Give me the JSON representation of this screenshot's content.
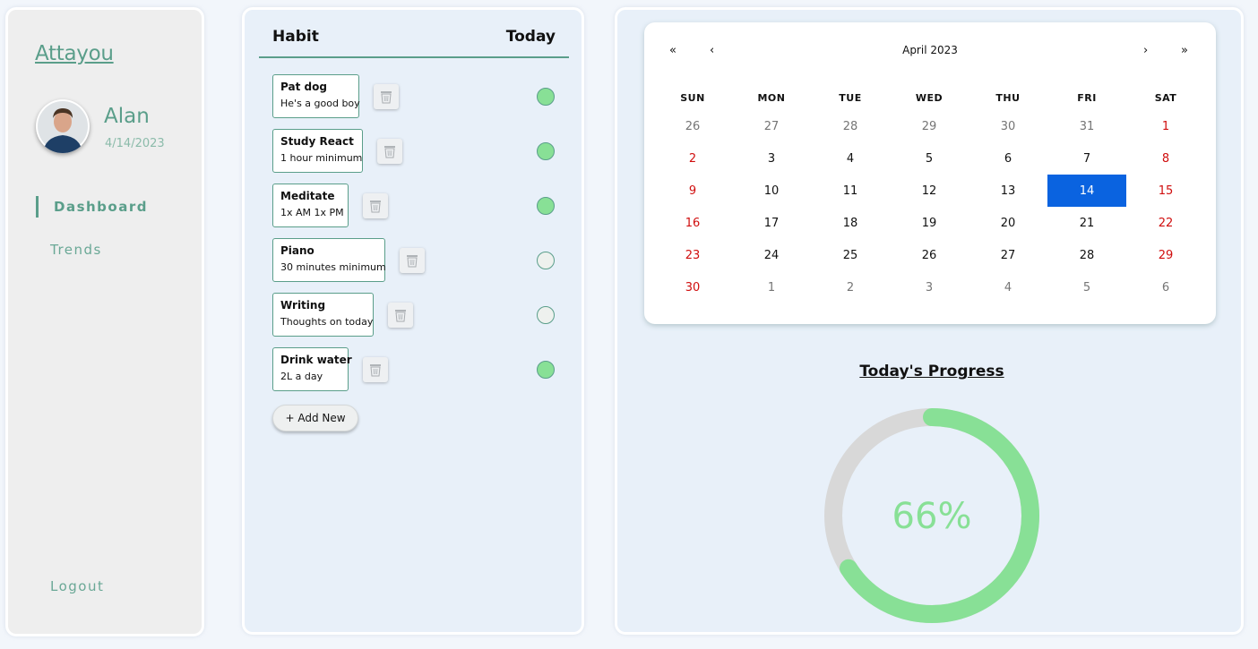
{
  "sidebar": {
    "brand": "Attayou",
    "user": {
      "name": "Alan",
      "date": "4/14/2023"
    },
    "nav": [
      {
        "label": "Dashboard",
        "active": true
      },
      {
        "label": "Trends",
        "active": false
      }
    ],
    "logout_label": "Logout"
  },
  "habits": {
    "header": {
      "habit": "Habit",
      "today": "Today"
    },
    "items": [
      {
        "title": "Pat dog",
        "desc": "He's a good boy",
        "done": true
      },
      {
        "title": "Study React",
        "desc": "1 hour minimum",
        "done": true
      },
      {
        "title": "Meditate",
        "desc": "1x AM 1x PM",
        "done": true
      },
      {
        "title": "Piano",
        "desc": "30 minutes minimum",
        "done": false
      },
      {
        "title": "Writing",
        "desc": "Thoughts on today",
        "done": false
      },
      {
        "title": "Drink water",
        "desc": "2L a day",
        "done": true
      }
    ],
    "add_label": "+ Add New"
  },
  "calendar": {
    "nav": {
      "prev_year": "«",
      "prev_month": "‹",
      "next_month": "›",
      "next_year": "»"
    },
    "month_label": "April 2023",
    "weekdays": [
      "SUN",
      "MON",
      "TUE",
      "WED",
      "THU",
      "FRI",
      "SAT"
    ],
    "weeks": [
      [
        "26",
        "27",
        "28",
        "29",
        "30",
        "31",
        "1"
      ],
      [
        "2",
        "3",
        "4",
        "5",
        "6",
        "7",
        "8"
      ],
      [
        "9",
        "10",
        "11",
        "12",
        "13",
        "14",
        "15"
      ],
      [
        "16",
        "17",
        "18",
        "19",
        "20",
        "21",
        "22"
      ],
      [
        "23",
        "24",
        "25",
        "26",
        "27",
        "28",
        "29"
      ],
      [
        "30",
        "1",
        "2",
        "3",
        "4",
        "5",
        "6"
      ]
    ],
    "selected": "14"
  },
  "progress": {
    "title": "Today's Progress",
    "percent_label": "66%",
    "fraction": 0.66,
    "colors": {
      "fill": "#88e096",
      "track": "#d8d8d8"
    }
  }
}
